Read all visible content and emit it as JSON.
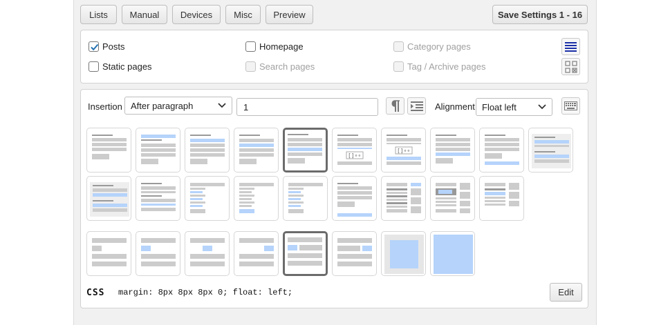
{
  "tabs": [
    {
      "label": "Lists"
    },
    {
      "label": "Manual"
    },
    {
      "label": "Devices"
    },
    {
      "label": "Misc"
    },
    {
      "label": "Preview"
    }
  ],
  "save_button": "Save Settings 1 - 16",
  "page_types": [
    {
      "label": "Posts",
      "checked": true,
      "disabled": false
    },
    {
      "label": "Homepage",
      "checked": false,
      "disabled": false
    },
    {
      "label": "Category pages",
      "checked": false,
      "disabled": true
    },
    {
      "label": "Static pages",
      "checked": false,
      "disabled": false
    },
    {
      "label": "Search pages",
      "checked": false,
      "disabled": true
    },
    {
      "label": "Tag / Archive pages",
      "checked": false,
      "disabled": true
    }
  ],
  "insertion": {
    "label": "Insertion",
    "selected": "After paragraph",
    "value": "1"
  },
  "alignment": {
    "label": "Alignment",
    "selected": "Float left"
  },
  "css": {
    "label": "CSS",
    "code": "margin: 8px 8px 8px 0; float: left;"
  },
  "edit_button": "Edit",
  "colors": {
    "highlight": "#b5d3fb",
    "block": "#cccccc",
    "selected_border": "#6b6b6b",
    "accent_blue": "#1a2fa8"
  }
}
